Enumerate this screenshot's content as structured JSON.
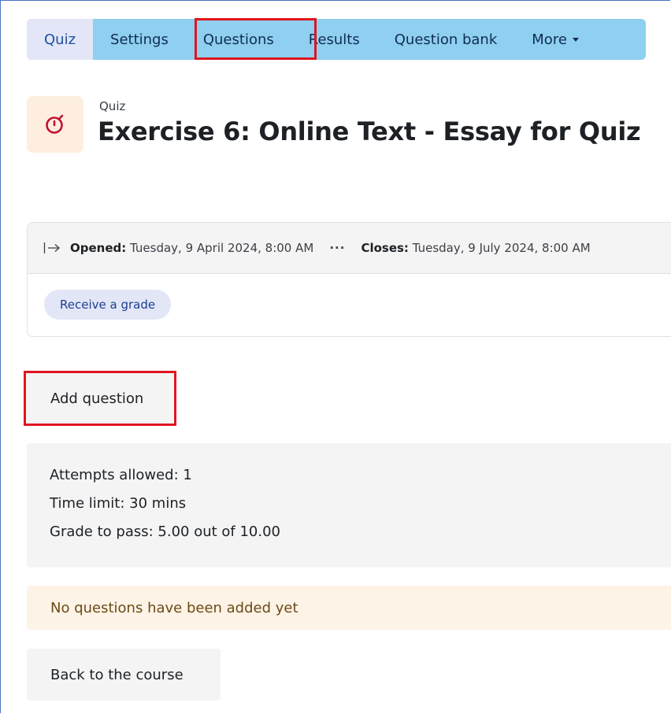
{
  "nav": {
    "tabs": [
      {
        "label": "Quiz"
      },
      {
        "label": "Settings"
      },
      {
        "label": "Questions"
      },
      {
        "label": "Results"
      },
      {
        "label": "Question bank"
      },
      {
        "label": "More"
      }
    ],
    "active_tab": "Quiz",
    "highlighted_tab": "Questions"
  },
  "header": {
    "activity_type": "Quiz",
    "title": "Exercise 6: Online Text - Essay for Quiz",
    "icon": "stopwatch-icon"
  },
  "dates": {
    "opened_label": "Opened:",
    "opened_value": "Tuesday, 9 April 2024, 8:00 AM",
    "separator": "···",
    "closes_label": "Closes:",
    "closes_value": "Tuesday, 9 July 2024, 8:00 AM"
  },
  "completion": {
    "badge": "Receive a grade"
  },
  "actions": {
    "add_question": "Add question",
    "back_to_course": "Back to the course"
  },
  "quiz_info": {
    "attempts": "Attempts allowed: 1",
    "time_limit": "Time limit: 30 mins",
    "grade_to_pass": "Grade to pass: 5.00 out of 10.00"
  },
  "notice": {
    "text": "No questions have been added yet"
  },
  "colors": {
    "nav_bar": "#8fcff0",
    "active_tab": "#e2e6f6",
    "highlight": "#e0151f",
    "icon_bg": "#fdeee0",
    "icon_stroke": "#c4122f",
    "notice_bg": "#fdf3e6"
  }
}
